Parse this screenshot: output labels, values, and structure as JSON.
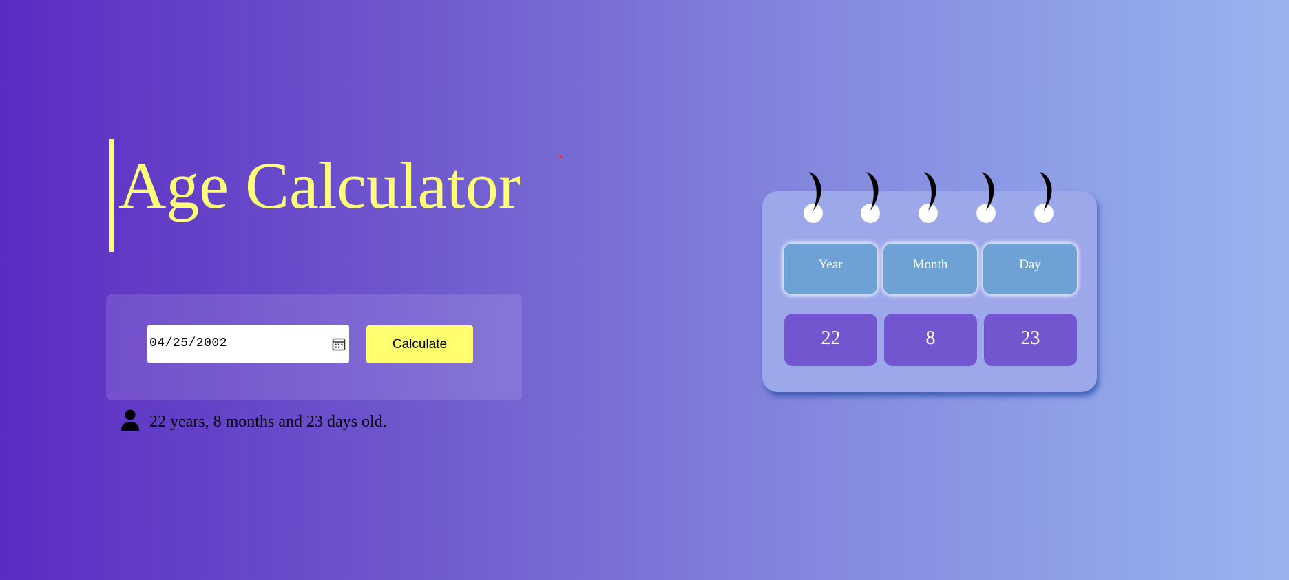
{
  "header": {
    "title": "Age Calculator"
  },
  "form": {
    "date_value": "04/25/2002",
    "calculate_label": "Calculate"
  },
  "result": {
    "text": "22 years, 8 months and 23 days old."
  },
  "calendar": {
    "headers": [
      "Year",
      "Month",
      "Day"
    ],
    "values": [
      "22",
      "8",
      "23"
    ]
  },
  "icons": {
    "calendar_picker": "calendar-icon",
    "person": "user-icon",
    "binder_rings": "binder-ring-icon"
  },
  "colors": {
    "title": "#ffff78",
    "button": "#ffff70",
    "header_cell": "#6fa2d4",
    "value_cell": "#7156cf",
    "card": "#9ca8ea"
  }
}
